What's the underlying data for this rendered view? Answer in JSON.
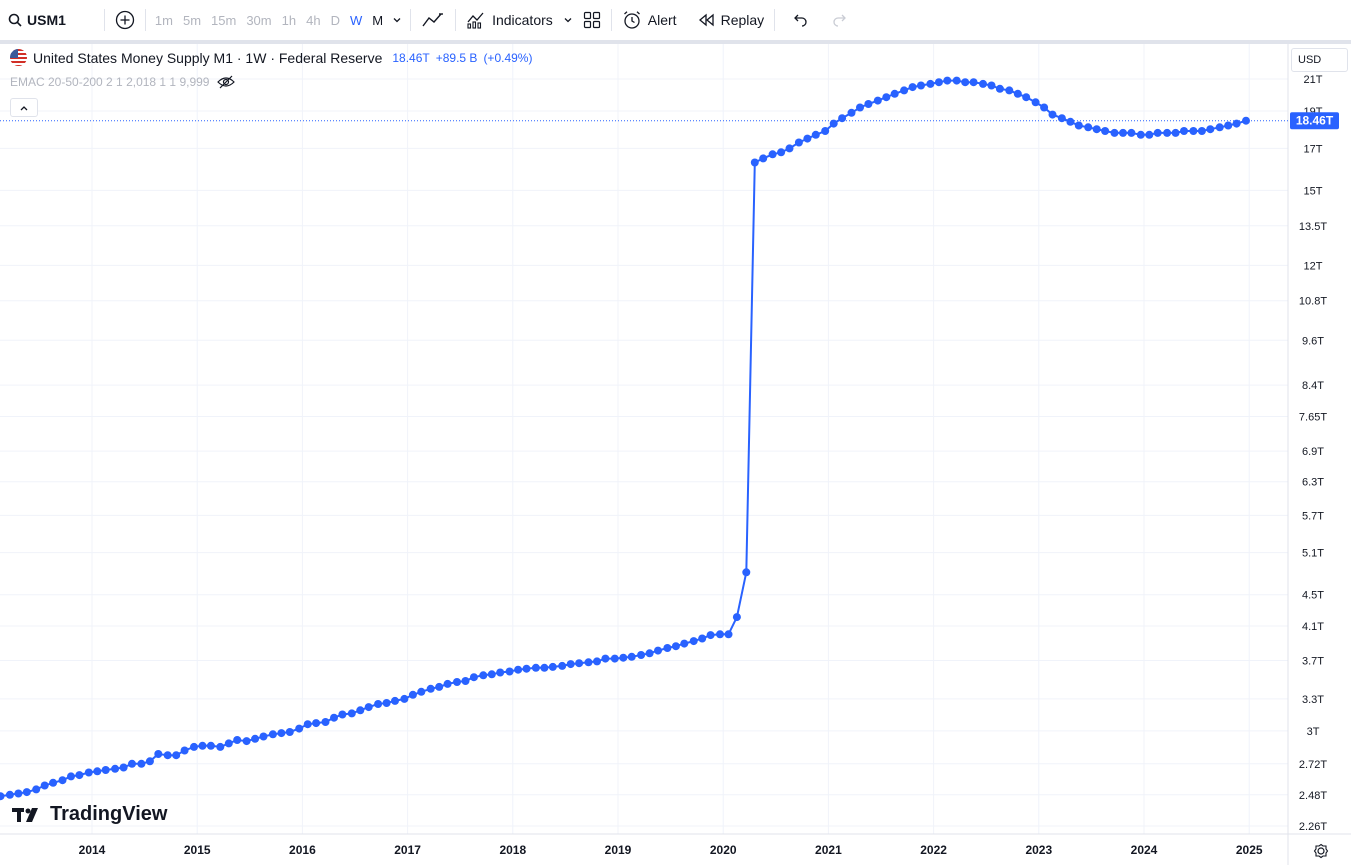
{
  "toolbar": {
    "symbol": "USM1",
    "intervals": [
      "1m",
      "5m",
      "15m",
      "30m",
      "1h",
      "4h",
      "D",
      "W",
      "M"
    ],
    "active_interval": "W",
    "indicators_label": "Indicators",
    "alert_label": "Alert",
    "replay_label": "Replay"
  },
  "legend": {
    "title": "United States Money Supply M1 · 1W · Federal Reserve",
    "last_value": "18.46T",
    "change": "+89.5 B",
    "change_pct": "(+0.49%)",
    "indicator": "EMAC 20-50-200 2 1 2,018 1 1 9,999"
  },
  "currency": "USD",
  "logo_text": "TradingView",
  "colors": {
    "series": "#2962ff",
    "grid": "#f0f3fa",
    "label_bg": "#2962ff"
  },
  "chart_data": {
    "type": "line",
    "scale": "log",
    "y_unit": "T (USD trillions)",
    "last_price_label": "18.46T",
    "last_price": 18.46,
    "y_ticks": [
      {
        "label": "21T",
        "value": 20.9
      },
      {
        "label": "19T",
        "value": 19.0
      },
      {
        "label": "17T",
        "value": 17.0
      },
      {
        "label": "15T",
        "value": 15.0
      },
      {
        "label": "13.5T",
        "value": 13.5
      },
      {
        "label": "12T",
        "value": 12.0
      },
      {
        "label": "10.8T",
        "value": 10.8
      },
      {
        "label": "9.6T",
        "value": 9.6
      },
      {
        "label": "8.4T",
        "value": 8.4
      },
      {
        "label": "7.65T",
        "value": 7.65
      },
      {
        "label": "6.9T",
        "value": 6.9
      },
      {
        "label": "6.3T",
        "value": 6.3
      },
      {
        "label": "5.7T",
        "value": 5.7
      },
      {
        "label": "5.1T",
        "value": 5.1
      },
      {
        "label": "4.5T",
        "value": 4.5
      },
      {
        "label": "4.1T",
        "value": 4.1
      },
      {
        "label": "3.7T",
        "value": 3.7
      },
      {
        "label": "3.3T",
        "value": 3.3
      },
      {
        "label": "3T",
        "value": 3.0
      },
      {
        "label": "2.72T",
        "value": 2.72
      },
      {
        "label": "2.48T",
        "value": 2.48
      },
      {
        "label": "2.26T",
        "value": 2.26
      }
    ],
    "x_ticks": [
      {
        "label": "2014",
        "value": 2014.0
      },
      {
        "label": "2015",
        "value": 2015.0
      },
      {
        "label": "2016",
        "value": 2016.0
      },
      {
        "label": "2017",
        "value": 2017.0
      },
      {
        "label": "2018",
        "value": 2018.0
      },
      {
        "label": "2019",
        "value": 2019.0
      },
      {
        "label": "2020",
        "value": 2020.0
      },
      {
        "label": "2021",
        "value": 2021.0
      },
      {
        "label": "2022",
        "value": 2022.0
      },
      {
        "label": "2023",
        "value": 2023.0
      },
      {
        "label": "2024",
        "value": 2024.0
      },
      {
        "label": "2025",
        "value": 2025.0
      }
    ],
    "series": [
      {
        "values": [
          [
            2013.05,
            2.45
          ],
          [
            2013.13,
            2.47
          ],
          [
            2013.22,
            2.48
          ],
          [
            2013.3,
            2.49
          ],
          [
            2013.38,
            2.5
          ],
          [
            2013.47,
            2.52
          ],
          [
            2013.55,
            2.55
          ],
          [
            2013.63,
            2.57
          ],
          [
            2013.72,
            2.59
          ],
          [
            2013.8,
            2.62
          ],
          [
            2013.88,
            2.63
          ],
          [
            2013.97,
            2.65
          ],
          [
            2014.05,
            2.66
          ],
          [
            2014.13,
            2.67
          ],
          [
            2014.22,
            2.68
          ],
          [
            2014.3,
            2.69
          ],
          [
            2014.38,
            2.72
          ],
          [
            2014.47,
            2.72
          ],
          [
            2014.55,
            2.74
          ],
          [
            2014.63,
            2.8
          ],
          [
            2014.72,
            2.79
          ],
          [
            2014.8,
            2.79
          ],
          [
            2014.88,
            2.83
          ],
          [
            2014.97,
            2.86
          ],
          [
            2015.05,
            2.87
          ],
          [
            2015.13,
            2.87
          ],
          [
            2015.22,
            2.86
          ],
          [
            2015.3,
            2.89
          ],
          [
            2015.38,
            2.92
          ],
          [
            2015.47,
            2.91
          ],
          [
            2015.55,
            2.93
          ],
          [
            2015.63,
            2.95
          ],
          [
            2015.72,
            2.97
          ],
          [
            2015.8,
            2.98
          ],
          [
            2015.88,
            2.99
          ],
          [
            2015.97,
            3.02
          ],
          [
            2016.05,
            3.06
          ],
          [
            2016.13,
            3.07
          ],
          [
            2016.22,
            3.08
          ],
          [
            2016.3,
            3.12
          ],
          [
            2016.38,
            3.15
          ],
          [
            2016.47,
            3.16
          ],
          [
            2016.55,
            3.19
          ],
          [
            2016.63,
            3.22
          ],
          [
            2016.72,
            3.25
          ],
          [
            2016.8,
            3.26
          ],
          [
            2016.88,
            3.28
          ],
          [
            2016.97,
            3.3
          ],
          [
            2017.05,
            3.34
          ],
          [
            2017.13,
            3.37
          ],
          [
            2017.22,
            3.4
          ],
          [
            2017.3,
            3.42
          ],
          [
            2017.38,
            3.45
          ],
          [
            2017.47,
            3.47
          ],
          [
            2017.55,
            3.48
          ],
          [
            2017.63,
            3.52
          ],
          [
            2017.72,
            3.54
          ],
          [
            2017.8,
            3.55
          ],
          [
            2017.88,
            3.57
          ],
          [
            2017.97,
            3.58
          ],
          [
            2018.05,
            3.6
          ],
          [
            2018.13,
            3.61
          ],
          [
            2018.22,
            3.62
          ],
          [
            2018.3,
            3.62
          ],
          [
            2018.38,
            3.63
          ],
          [
            2018.47,
            3.64
          ],
          [
            2018.55,
            3.66
          ],
          [
            2018.63,
            3.67
          ],
          [
            2018.72,
            3.68
          ],
          [
            2018.8,
            3.69
          ],
          [
            2018.88,
            3.72
          ],
          [
            2018.97,
            3.72
          ],
          [
            2019.05,
            3.73
          ],
          [
            2019.13,
            3.74
          ],
          [
            2019.22,
            3.76
          ],
          [
            2019.3,
            3.78
          ],
          [
            2019.38,
            3.81
          ],
          [
            2019.47,
            3.84
          ],
          [
            2019.55,
            3.86
          ],
          [
            2019.63,
            3.89
          ],
          [
            2019.72,
            3.92
          ],
          [
            2019.8,
            3.95
          ],
          [
            2019.88,
            3.99
          ],
          [
            2019.97,
            4.0
          ],
          [
            2020.05,
            4.0
          ],
          [
            2020.13,
            4.21
          ],
          [
            2020.22,
            4.81
          ],
          [
            2020.3,
            16.3
          ],
          [
            2020.38,
            16.5
          ],
          [
            2020.47,
            16.7
          ],
          [
            2020.55,
            16.8
          ],
          [
            2020.63,
            17.0
          ],
          [
            2020.72,
            17.3
          ],
          [
            2020.8,
            17.5
          ],
          [
            2020.88,
            17.7
          ],
          [
            2020.97,
            17.9
          ],
          [
            2021.05,
            18.3
          ],
          [
            2021.13,
            18.6
          ],
          [
            2021.22,
            18.9
          ],
          [
            2021.3,
            19.2
          ],
          [
            2021.38,
            19.4
          ],
          [
            2021.47,
            19.6
          ],
          [
            2021.55,
            19.8
          ],
          [
            2021.63,
            20.0
          ],
          [
            2021.72,
            20.2
          ],
          [
            2021.8,
            20.4
          ],
          [
            2021.88,
            20.5
          ],
          [
            2021.97,
            20.6
          ],
          [
            2022.05,
            20.7
          ],
          [
            2022.13,
            20.8
          ],
          [
            2022.22,
            20.8
          ],
          [
            2022.3,
            20.7
          ],
          [
            2022.38,
            20.7
          ],
          [
            2022.47,
            20.6
          ],
          [
            2022.55,
            20.5
          ],
          [
            2022.63,
            20.3
          ],
          [
            2022.72,
            20.2
          ],
          [
            2022.8,
            20.0
          ],
          [
            2022.88,
            19.8
          ],
          [
            2022.97,
            19.5
          ],
          [
            2023.05,
            19.2
          ],
          [
            2023.13,
            18.8
          ],
          [
            2023.22,
            18.6
          ],
          [
            2023.3,
            18.4
          ],
          [
            2023.38,
            18.2
          ],
          [
            2023.47,
            18.1
          ],
          [
            2023.55,
            18.0
          ],
          [
            2023.63,
            17.9
          ],
          [
            2023.72,
            17.8
          ],
          [
            2023.8,
            17.8
          ],
          [
            2023.88,
            17.8
          ],
          [
            2023.97,
            17.7
          ],
          [
            2024.05,
            17.7
          ],
          [
            2024.13,
            17.8
          ],
          [
            2024.22,
            17.8
          ],
          [
            2024.3,
            17.8
          ],
          [
            2024.38,
            17.9
          ],
          [
            2024.47,
            17.9
          ],
          [
            2024.55,
            17.9
          ],
          [
            2024.63,
            18.0
          ],
          [
            2024.72,
            18.1
          ],
          [
            2024.8,
            18.2
          ],
          [
            2024.88,
            18.3
          ],
          [
            2024.97,
            18.46
          ]
        ]
      }
    ]
  }
}
